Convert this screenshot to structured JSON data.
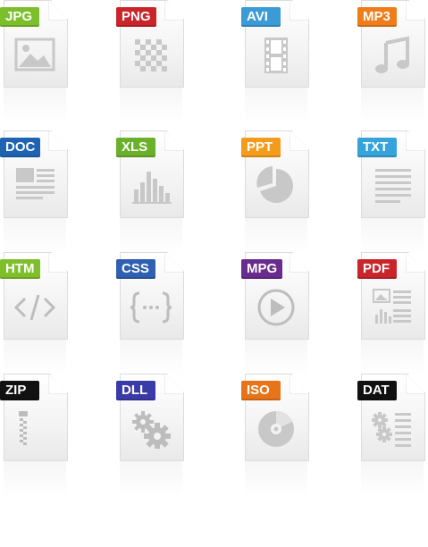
{
  "icons": [
    {
      "ext": "JPG",
      "color": "#7cbf2a",
      "glyph": "image-icon"
    },
    {
      "ext": "PNG",
      "color": "#c9252b",
      "glyph": "checkerboard-icon"
    },
    {
      "ext": "AVI",
      "color": "#3a9bd5",
      "glyph": "film-icon"
    },
    {
      "ext": "MP3",
      "color": "#ef7d1a",
      "glyph": "music-note-icon"
    },
    {
      "ext": "DOC",
      "color": "#1f63b3",
      "glyph": "document-layout-icon"
    },
    {
      "ext": "XLS",
      "color": "#6bb02a",
      "glyph": "bar-chart-icon"
    },
    {
      "ext": "PPT",
      "color": "#f39c1b",
      "glyph": "pie-chart-icon"
    },
    {
      "ext": "TXT",
      "color": "#35a4db",
      "glyph": "text-lines-icon"
    },
    {
      "ext": "HTM",
      "color": "#7fbf2b",
      "glyph": "code-icon"
    },
    {
      "ext": "CSS",
      "color": "#2f5fb0",
      "glyph": "braces-icon"
    },
    {
      "ext": "MPG",
      "color": "#6a2b8f",
      "glyph": "play-icon"
    },
    {
      "ext": "PDF",
      "color": "#c9252b",
      "glyph": "pdf-layout-icon"
    },
    {
      "ext": "ZIP",
      "color": "#111111",
      "glyph": "zipper-icon"
    },
    {
      "ext": "DLL",
      "color": "#3a3aa8",
      "glyph": "gears-icon"
    },
    {
      "ext": "ISO",
      "color": "#e8741a",
      "glyph": "disc-icon"
    },
    {
      "ext": "DAT",
      "color": "#111111",
      "glyph": "gear-list-icon"
    }
  ]
}
